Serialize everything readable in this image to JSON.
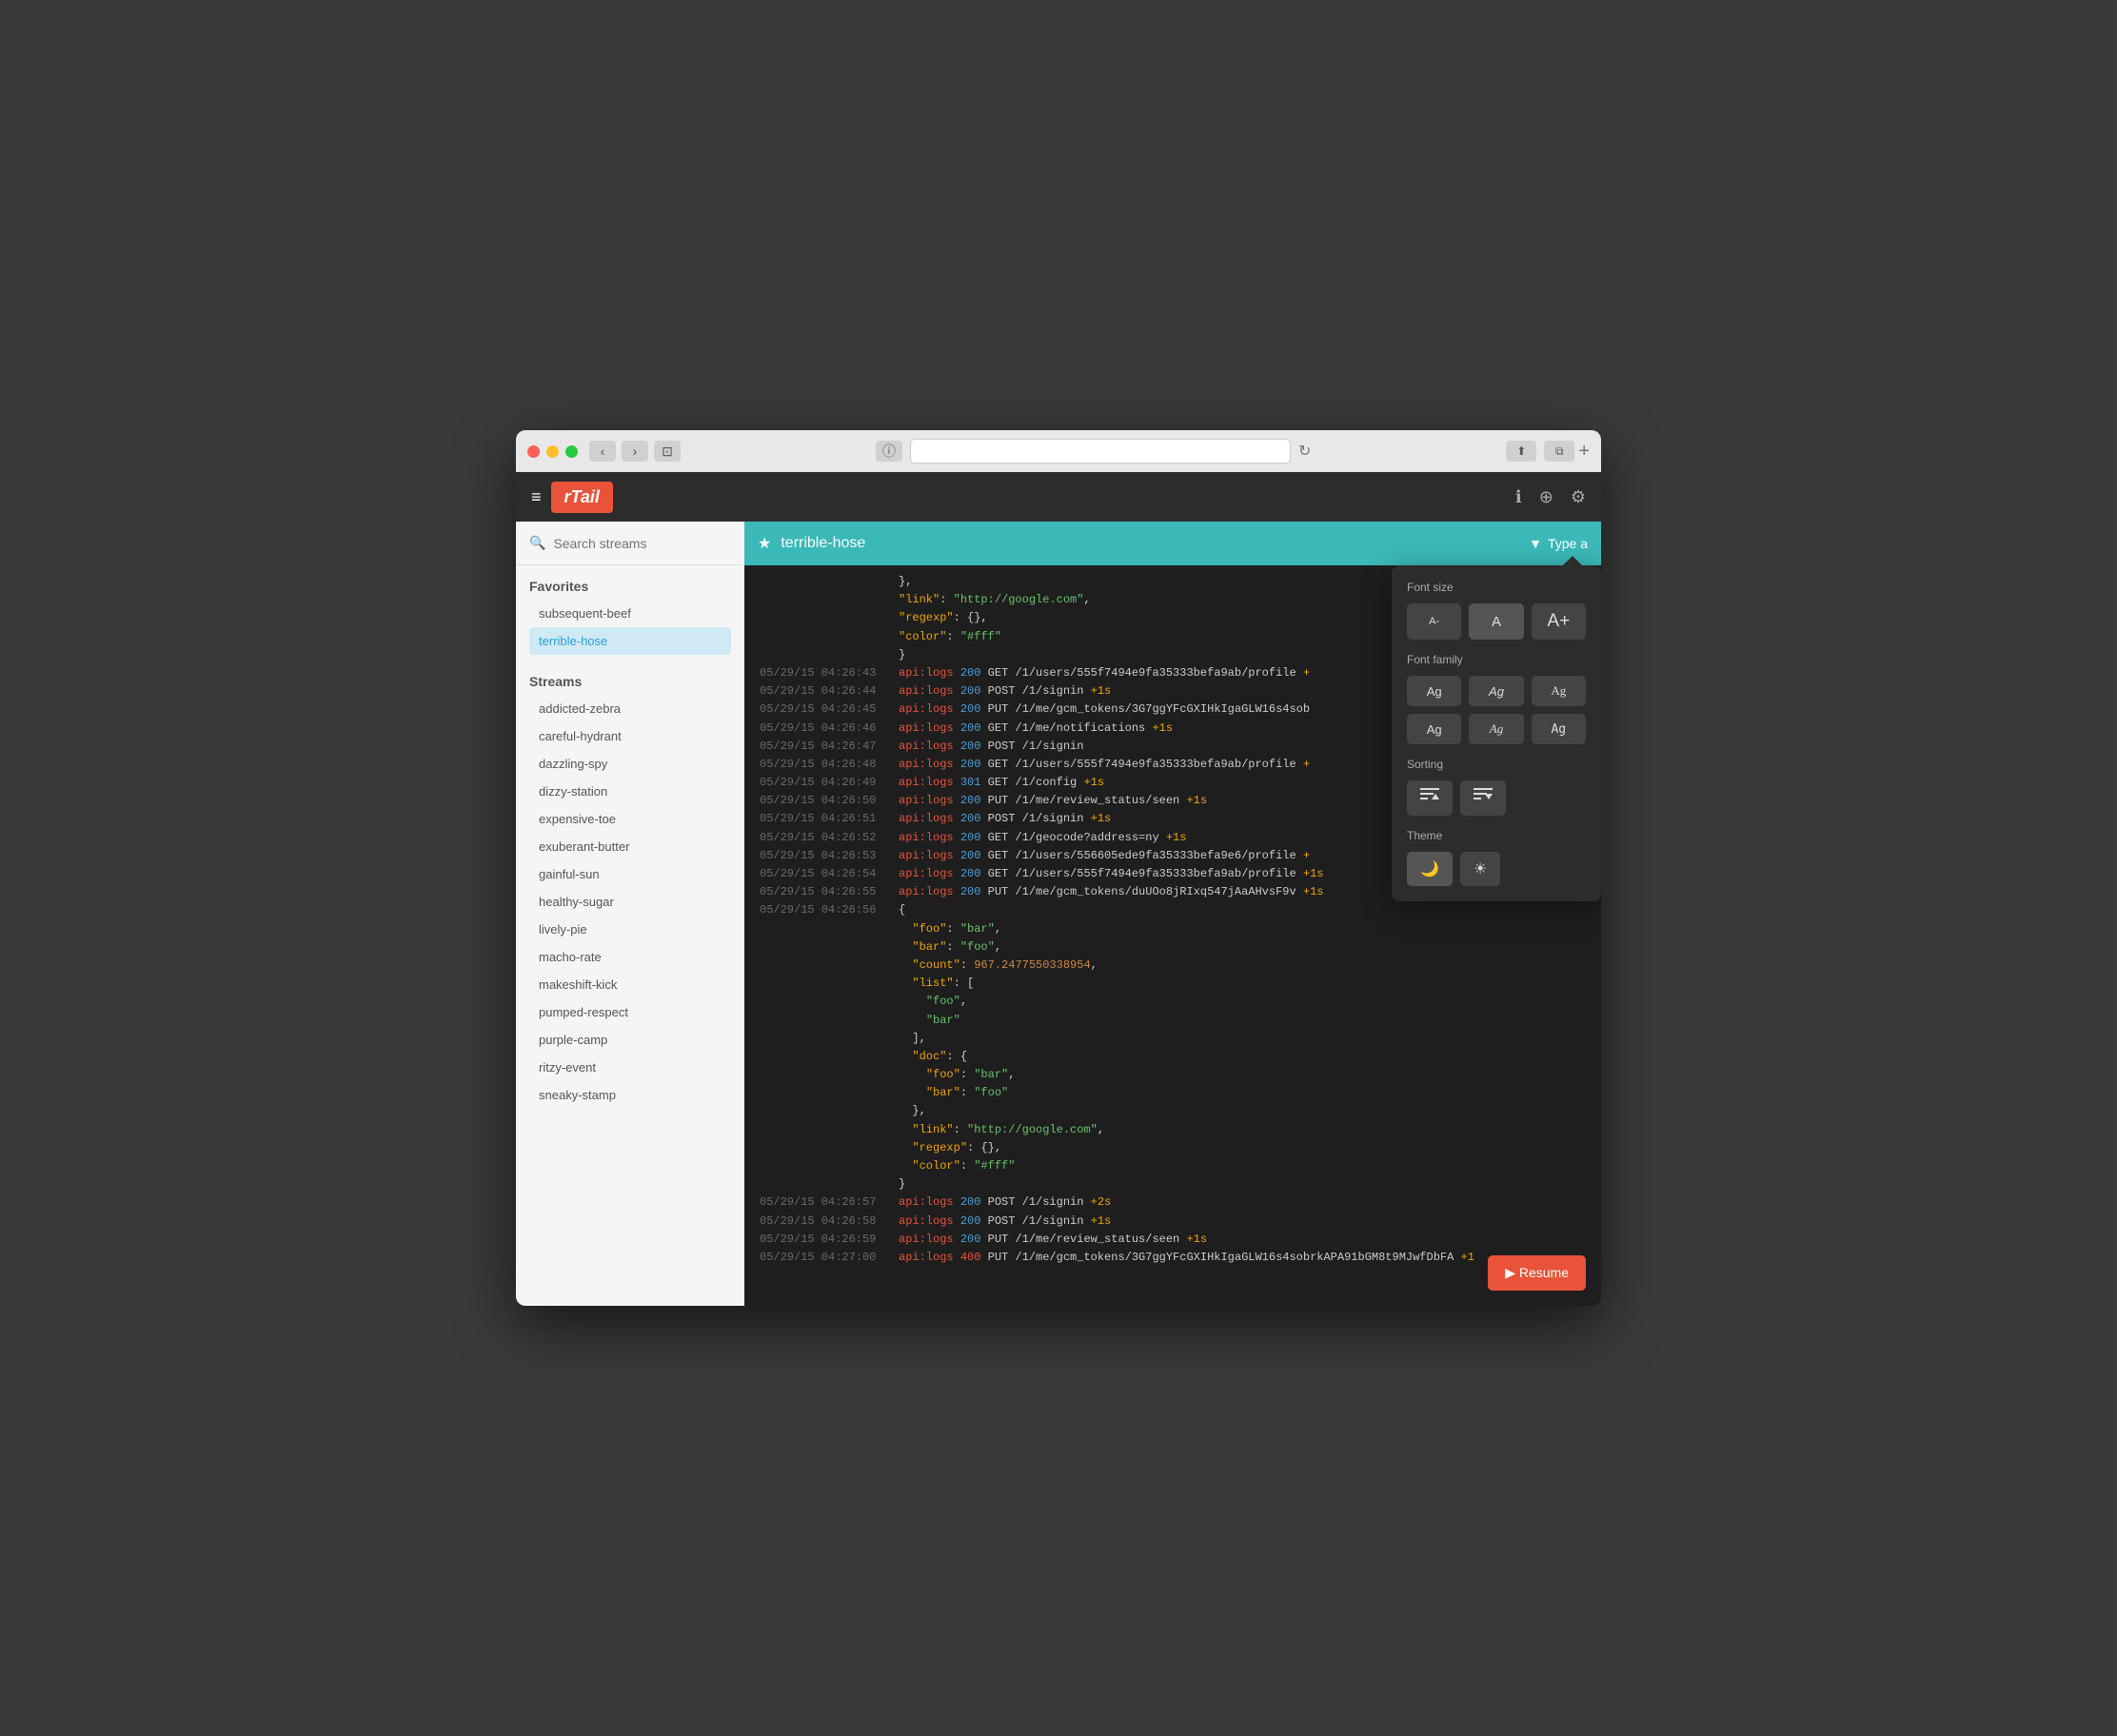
{
  "window": {
    "title": "rTail"
  },
  "titlebar": {
    "back_label": "‹",
    "forward_label": "›",
    "reader_label": "⊡",
    "reload_label": "↻",
    "share_label": "⬆",
    "fullscreen_label": "⧉",
    "new_tab_label": "+"
  },
  "app_header": {
    "hamburger": "≡",
    "logo": "rTail",
    "info_icon": "ℹ",
    "globe_icon": "⊕",
    "gear_icon": "⚙"
  },
  "sidebar": {
    "search_placeholder": "Search streams",
    "favorites_title": "Favorites",
    "favorites": [
      {
        "label": "subsequent-beef",
        "active": false
      },
      {
        "label": "terrible-hose",
        "active": true
      }
    ],
    "streams_title": "Streams",
    "streams": [
      {
        "label": "addicted-zebra"
      },
      {
        "label": "careful-hydrant"
      },
      {
        "label": "dazzling-spy"
      },
      {
        "label": "dizzy-station"
      },
      {
        "label": "expensive-toe"
      },
      {
        "label": "exuberant-butter"
      },
      {
        "label": "gainful-sun"
      },
      {
        "label": "healthy-sugar"
      },
      {
        "label": "lively-pie"
      },
      {
        "label": "macho-rate"
      },
      {
        "label": "makeshift-kick"
      },
      {
        "label": "pumped-respect"
      },
      {
        "label": "purple-camp"
      },
      {
        "label": "ritzy-event"
      },
      {
        "label": "sneaky-stamp"
      }
    ]
  },
  "stream": {
    "name": "terrible-hose",
    "filter_placeholder": "Type a"
  },
  "logs": {
    "lines": [
      {
        "ts": "",
        "content": "},",
        "type": "brace"
      },
      {
        "ts": "",
        "content": "\"link\": \"http://google.com\",",
        "type": "json"
      },
      {
        "ts": "",
        "content": "\"regexp\": {},",
        "type": "json"
      },
      {
        "ts": "",
        "content": "\"color\": \"#fff\"",
        "type": "json"
      },
      {
        "ts": "",
        "content": "}",
        "type": "brace"
      },
      {
        "ts": "05/29/15 04:26:43",
        "tag": "api:logs",
        "status": "200",
        "method": "GET",
        "path": "/1/users/555f7494e9fa35333befa9ab/profile",
        "delta": "+",
        "type": "log"
      },
      {
        "ts": "05/29/15 04:26:44",
        "tag": "api:logs",
        "status": "200",
        "method": "POST",
        "path": "/1/signin",
        "delta": "+1s",
        "type": "log"
      },
      {
        "ts": "05/29/15 04:26:45",
        "tag": "api:logs",
        "status": "200",
        "method": "PUT",
        "path": "/1/me/gcm_tokens/3G7ggYFcGXIHkIgaGLW16s4sob",
        "delta": "",
        "type": "log"
      },
      {
        "ts": "05/29/15 04:26:46",
        "tag": "api:logs",
        "status": "200",
        "method": "GET",
        "path": "/1/me/notifications",
        "delta": "+1s",
        "type": "log"
      },
      {
        "ts": "05/29/15 04:26:47",
        "tag": "api:logs",
        "status": "200",
        "method": "POST",
        "path": "/1/signin",
        "delta": "",
        "type": "log"
      },
      {
        "ts": "05/29/15 04:26:48",
        "tag": "api:logs",
        "status": "200",
        "method": "GET",
        "path": "/1/users/555f7494e9fa35333befa9ab/profile",
        "delta": "+",
        "type": "log"
      },
      {
        "ts": "05/29/15 04:26:49",
        "tag": "api:logs",
        "status": "301",
        "method": "GET",
        "path": "/1/config",
        "delta": "+1s",
        "type": "log"
      },
      {
        "ts": "05/29/15 04:26:50",
        "tag": "api:logs",
        "status": "200",
        "method": "PUT",
        "path": "/1/me/review_status/seen",
        "delta": "+1s",
        "type": "log"
      },
      {
        "ts": "05/29/15 04:26:51",
        "tag": "api:logs",
        "status": "200",
        "method": "POST",
        "path": "/1/signin",
        "delta": "+1s",
        "type": "log"
      },
      {
        "ts": "05/29/15 04:26:52",
        "tag": "api:logs",
        "status": "200",
        "method": "GET",
        "path": "/1/geocode?address=ny",
        "delta": "+1s",
        "type": "log"
      },
      {
        "ts": "05/29/15 04:26:53",
        "tag": "api:logs",
        "status": "200",
        "method": "GET",
        "path": "/1/users/556605ede9fa35333befa9e6/profile",
        "delta": "+",
        "type": "log"
      },
      {
        "ts": "05/29/15 04:26:54",
        "tag": "api:logs",
        "status": "200",
        "method": "GET",
        "path": "/1/users/555f7494e9fa35333befa9ab/profile",
        "delta": "+1s",
        "type": "log"
      },
      {
        "ts": "05/29/15 04:26:55",
        "tag": "api:logs",
        "status": "200",
        "method": "PUT",
        "path": "/1/me/gcm_tokens/duUOo8jRIxq547jAaAHvsF9v",
        "delta": "+1s",
        "type": "log"
      },
      {
        "ts": "05/29/15 04:26:56",
        "content": "json_block_2",
        "type": "json_block"
      },
      {
        "ts": "05/29/15 04:26:57",
        "tag": "api:logs",
        "status": "200",
        "method": "POST",
        "path": "/1/signin",
        "delta": "+2s",
        "type": "log"
      },
      {
        "ts": "05/29/15 04:26:58",
        "tag": "api:logs",
        "status": "200",
        "method": "POST",
        "path": "/1/signin",
        "delta": "+1s",
        "type": "log"
      },
      {
        "ts": "05/29/15 04:26:59",
        "tag": "api:logs",
        "status": "200",
        "method": "PUT",
        "path": "/1/me/review_status/seen",
        "delta": "+1s",
        "type": "log"
      },
      {
        "ts": "05/29/15 04:27:00",
        "tag": "api:logs",
        "status": "400",
        "method": "PUT",
        "path": "/1/me/gcm_tokens/3G7ggYFcGXIHkIgaGLW16s4sobrkAPA91bGM8t9MJwfDbFA",
        "delta": "+1",
        "type": "log"
      }
    ]
  },
  "popover": {
    "font_size_title": "Font size",
    "font_size_small": "A-",
    "font_size_med": "A",
    "font_size_large": "A+",
    "font_family_title": "Font family",
    "font_families": [
      "Ag",
      "Ag",
      "Ag",
      "Ag",
      "Ag",
      "Ag"
    ],
    "sorting_title": "Sorting",
    "sort_asc": "≡↑",
    "sort_desc": "≡↓",
    "theme_title": "Theme",
    "theme_dark": "🌙",
    "theme_light": "☀"
  },
  "resume_btn": "▶ Resume"
}
